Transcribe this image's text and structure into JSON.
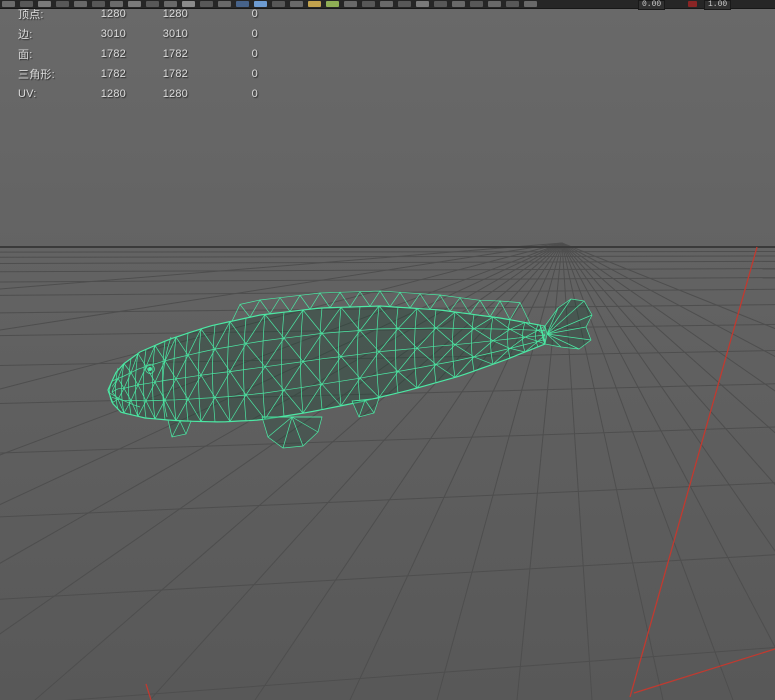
{
  "toolbar": {
    "field_min": "0.00",
    "field_max": "1.00"
  },
  "hud": {
    "rows": [
      {
        "label": "顶点:",
        "v1": "1280",
        "v2": "1280",
        "v3": "0"
      },
      {
        "label": "边:",
        "v1": "3010",
        "v2": "3010",
        "v3": "0"
      },
      {
        "label": "面:",
        "v1": "1782",
        "v2": "1782",
        "v3": "0"
      },
      {
        "label": "三角形:",
        "v1": "1782",
        "v2": "1782",
        "v3": "0"
      },
      {
        "label": "UV:",
        "v1": "1280",
        "v2": "1280",
        "v3": "0"
      }
    ]
  },
  "viewport": {
    "model": "fish-wireframe",
    "wireframe_color": "#4ce8a4",
    "frustum_color": "#c03a30",
    "grid_line_color": "#4e4e4e",
    "horizon_color": "#3a3a3a",
    "bg_top": "#696969",
    "bg_bottom": "#585858"
  }
}
